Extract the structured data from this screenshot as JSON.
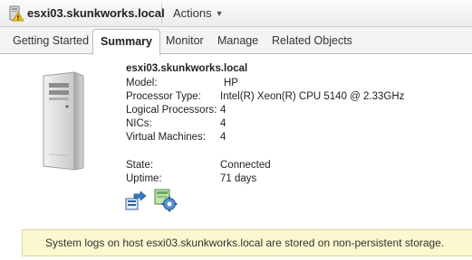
{
  "header": {
    "host_name": "esxi03.skunkworks.local",
    "actions_label": "Actions"
  },
  "tabs": [
    {
      "label": "Getting Started",
      "active": false
    },
    {
      "label": "Summary",
      "active": true
    },
    {
      "label": "Monitor",
      "active": false
    },
    {
      "label": "Manage",
      "active": false
    },
    {
      "label": "Related Objects",
      "active": false
    }
  ],
  "summary": {
    "host_name": "esxi03.skunkworks.local",
    "model_label": "Model:",
    "model_value": "HP",
    "processor_type_label": "Processor Type:",
    "processor_type_value": "Intel(R) Xeon(R) CPU 5140 @ 2.33GHz",
    "logical_processors_label": "Logical Processors:",
    "logical_processors_value": "4",
    "nics_label": "NICs:",
    "nics_value": "4",
    "virtual_machines_label": "Virtual Machines:",
    "virtual_machines_value": "4",
    "state_label": "State:",
    "state_value": "Connected",
    "uptime_label": "Uptime:",
    "uptime_value": "71 days"
  },
  "icons": {
    "host_warning": "host-warning-icon",
    "server": "server-tower-icon",
    "migrate": "migrate-vm-icon",
    "host_settings": "host-settings-icon"
  },
  "banner": {
    "message": "System logs on host esxi03.skunkworks.local are stored on non-persistent storage."
  },
  "colors": {
    "banner_background": "#fbf7cf",
    "banner_border": "#ddd59a",
    "warning_yellow": "#f3c218"
  }
}
